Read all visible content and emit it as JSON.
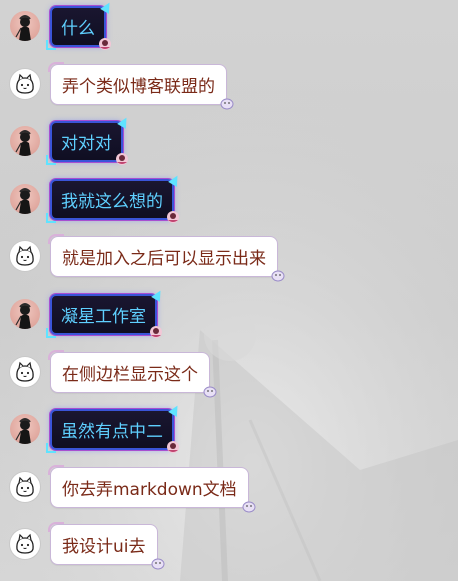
{
  "colors": {
    "background": "#d0d0d0",
    "dark_bubble_bg": "#14122a",
    "dark_bubble_text": "#5fd0ff",
    "dark_bubble_border": "#3a54d8",
    "light_bubble_bg": "#ffffff",
    "light_bubble_text": "#7a2a18",
    "light_bubble_border": "#c9b7d8"
  },
  "messages": [
    {
      "sender": "a",
      "avatar_icon": "dark-figure-avatar-icon",
      "text": "什么"
    },
    {
      "sender": "b",
      "avatar_icon": "white-cat-avatar-icon",
      "text": "弄个类似博客联盟的"
    },
    {
      "sender": "a",
      "avatar_icon": "dark-figure-avatar-icon",
      "text": "对对对"
    },
    {
      "sender": "a",
      "avatar_icon": "dark-figure-avatar-icon",
      "text": "我就这么想的"
    },
    {
      "sender": "b",
      "avatar_icon": "white-cat-avatar-icon",
      "text": "就是加入之后可以显示出来"
    },
    {
      "sender": "a",
      "avatar_icon": "dark-figure-avatar-icon",
      "text": "凝星工作室"
    },
    {
      "sender": "b",
      "avatar_icon": "white-cat-avatar-icon",
      "text": "在侧边栏显示这个"
    },
    {
      "sender": "a",
      "avatar_icon": "dark-figure-avatar-icon",
      "text": "虽然有点中二"
    },
    {
      "sender": "b",
      "avatar_icon": "white-cat-avatar-icon",
      "text": "你去弄markdown文档"
    },
    {
      "sender": "b",
      "avatar_icon": "white-cat-avatar-icon",
      "text": "我设计ui去"
    }
  ]
}
